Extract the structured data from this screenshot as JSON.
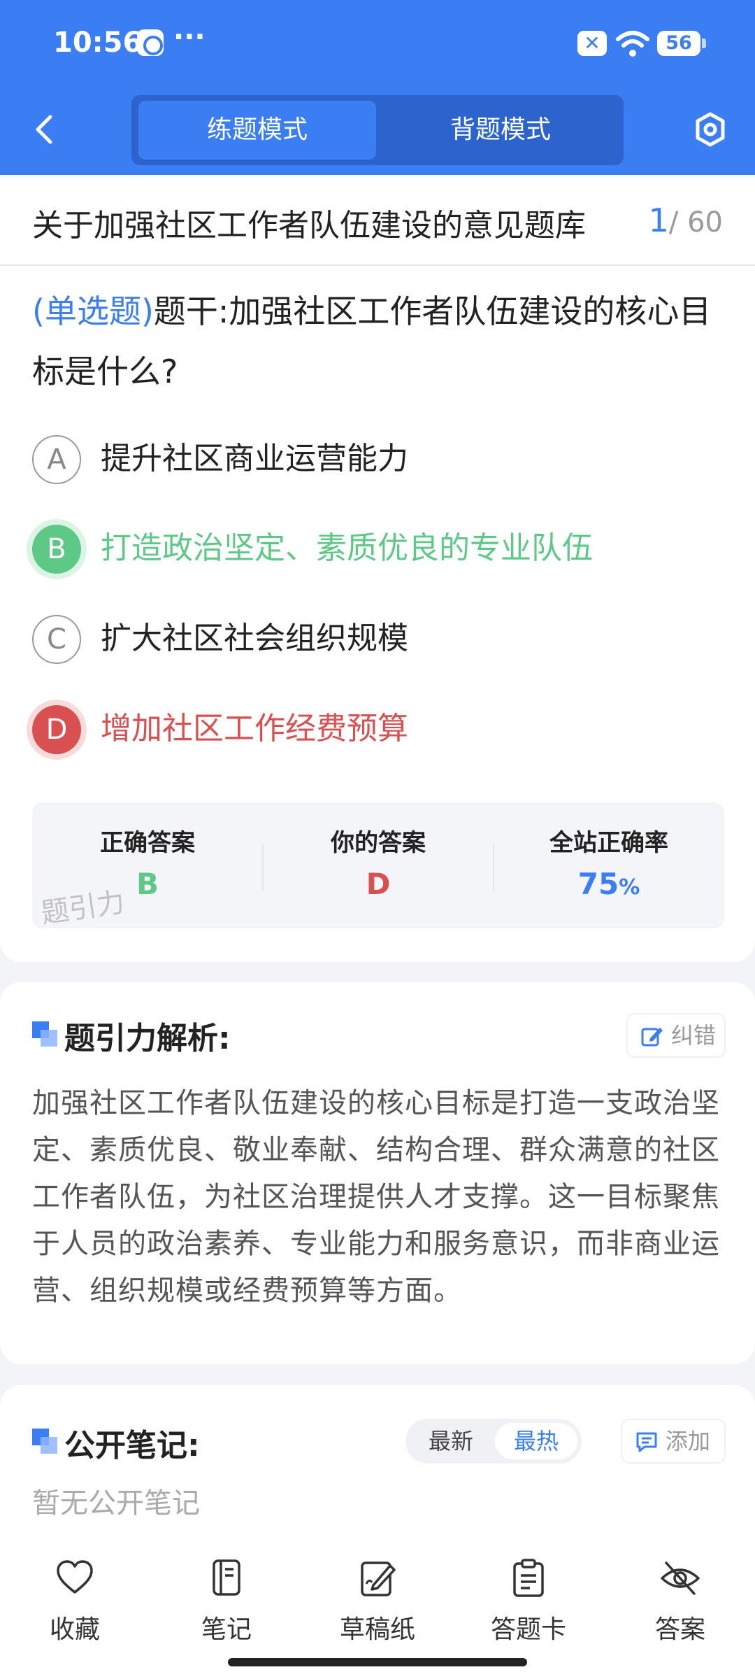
{
  "status_bar": {
    "time": "10:56",
    "more": "···",
    "battery": "56"
  },
  "header": {
    "tabs": [
      {
        "label": "练题模式",
        "active": true
      },
      {
        "label": "背题模式",
        "active": false
      }
    ]
  },
  "title_bar": {
    "title": "关于加强社区工作者队伍建设的意见题库",
    "current": "1",
    "total": "/ 60"
  },
  "question": {
    "type": "(单选题)",
    "stem": "题干:加强社区工作者队伍建设的核心目标是什么?",
    "options": [
      {
        "letter": "A",
        "text": "提升社区商业运营能力",
        "state": "normal"
      },
      {
        "letter": "B",
        "text": "打造政治坚定、素质优良的专业队伍",
        "state": "correct"
      },
      {
        "letter": "C",
        "text": "扩大社区社会组织规模",
        "state": "normal"
      },
      {
        "letter": "D",
        "text": "增加社区工作经费预算",
        "state": "wrong"
      }
    ]
  },
  "answers": {
    "correct_label": "正确答案",
    "correct_value": "B",
    "yours_label": "你的答案",
    "yours_value": "D",
    "rate_label": "全站正确率",
    "rate_value": "75",
    "rate_unit": "%",
    "watermark": "题引力"
  },
  "analysis": {
    "title": "题引力解析:",
    "report_label": "纠错",
    "body": "加强社区工作者队伍建设的核心目标是打造一支政治坚定、素质优良、敬业奉献、结构合理、群众满意的社区工作者队伍，为社区治理提供人才支撑。这一目标聚焦于人员的政治素养、专业能力和服务意识，而非商业运营、组织规模或经费预算等方面。"
  },
  "notes": {
    "title": "公开笔记:",
    "sort_latest": "最新",
    "sort_hot": "最热",
    "add_label": "添加",
    "empty_text": "暂无公开笔记"
  },
  "bottom_bar": {
    "items": [
      {
        "label": "收藏",
        "icon": "heart-icon"
      },
      {
        "label": "笔记",
        "icon": "notebook-icon"
      },
      {
        "label": "草稿纸",
        "icon": "draft-icon"
      },
      {
        "label": "答题卡",
        "icon": "clipboard-icon"
      },
      {
        "label": "答案",
        "icon": "eye-off-icon"
      }
    ]
  },
  "colors": {
    "primary": "#3b7ef4",
    "correct": "#5ec986",
    "wrong": "#d95050"
  }
}
